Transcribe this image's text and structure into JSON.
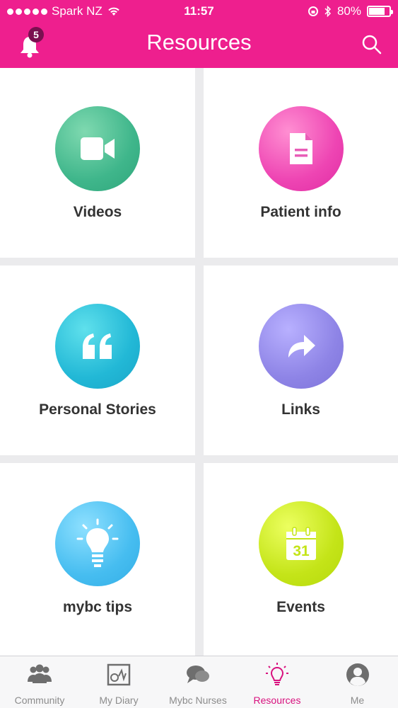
{
  "status_bar": {
    "carrier": "Spark NZ",
    "time": "11:57",
    "battery_percent": "80%",
    "battery_level": 0.8
  },
  "header": {
    "title": "Resources",
    "notification_count": "5",
    "icons": {
      "left": "bell-icon",
      "right": "search-icon"
    }
  },
  "colors": {
    "header": "#ee1f8e",
    "active_tab": "#d8117e",
    "inactive_tab": "#8c8c8c"
  },
  "tiles": [
    {
      "label": "Videos",
      "icon": "video-camera-icon",
      "color": "#3fb68b"
    },
    {
      "label": "Patient info",
      "icon": "document-icon",
      "color": "#ee45b3"
    },
    {
      "label": "Personal Stories",
      "icon": "quote-icon",
      "color": "#22b8d6"
    },
    {
      "label": "Links",
      "icon": "share-arrow-icon",
      "color": "#8e84e6"
    },
    {
      "label": "mybc tips",
      "icon": "lightbulb-icon",
      "color": "#46bdf0"
    },
    {
      "label": "Events",
      "icon": "calendar-icon",
      "color": "#c4e418",
      "calendar_day": "31"
    }
  ],
  "tabbar": {
    "tabs": [
      {
        "label": "Community",
        "icon": "community-icon",
        "active": false
      },
      {
        "label": "My Diary",
        "icon": "diary-icon",
        "active": false
      },
      {
        "label": "Mybc Nurses",
        "icon": "chat-bubbles-icon",
        "active": false
      },
      {
        "label": "Resources",
        "icon": "lightbulb-icon",
        "active": true
      },
      {
        "label": "Me",
        "icon": "profile-icon",
        "active": false
      }
    ]
  }
}
